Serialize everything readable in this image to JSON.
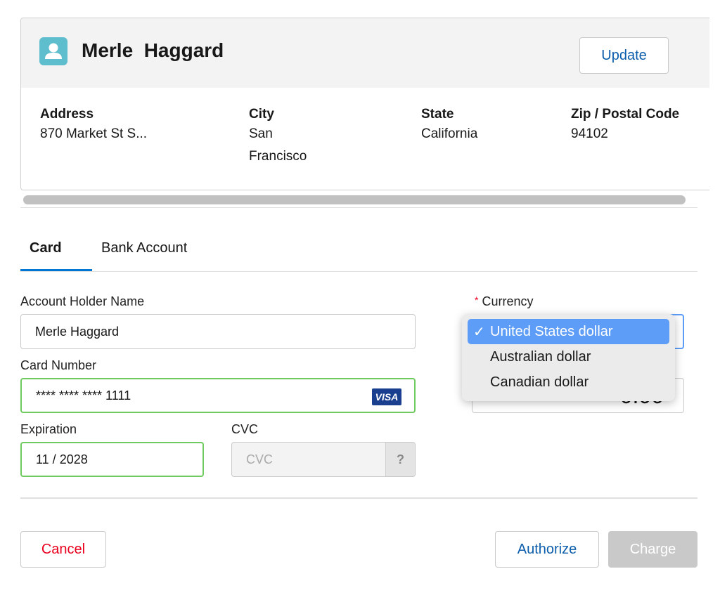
{
  "customer": {
    "name": "Merle  Haggard",
    "update_label": "Update"
  },
  "address": [
    {
      "label": "Address",
      "value": "870 Market St S..."
    },
    {
      "label": "City",
      "value": "San Francisco"
    },
    {
      "label": "State",
      "value": "California"
    },
    {
      "label": "Zip / Postal Code",
      "value": "94102"
    }
  ],
  "tabs": [
    {
      "label": "Card",
      "active": true
    },
    {
      "label": "Bank Account",
      "active": false
    }
  ],
  "form": {
    "holder_label": "Account Holder Name",
    "holder_value": "Merle Haggard",
    "card_label": "Card Number",
    "card_value": "**** **** **** 1111",
    "card_brand": "VISA",
    "exp_label": "Expiration",
    "exp_value": "11 / 2028",
    "cvc_label": "CVC",
    "cvc_placeholder": "CVC",
    "cvc_help": "?",
    "currency_label": "Currency",
    "required_mark": "*",
    "currency_options": [
      "United States dollar",
      "Australian dollar",
      "Canadian dollar"
    ],
    "currency_selected": "United States dollar",
    "check": "✓",
    "amount_symbol": "$",
    "amount_value": "0.00"
  },
  "actions": {
    "cancel": "Cancel",
    "authorize": "Authorize",
    "charge": "Charge"
  },
  "colors": {
    "accent": "#0b5cab",
    "cancel": "#ea001e",
    "valid": "#6fcb5f",
    "avatar": "#5fbecd",
    "menu_selected": "#5d9df7"
  }
}
